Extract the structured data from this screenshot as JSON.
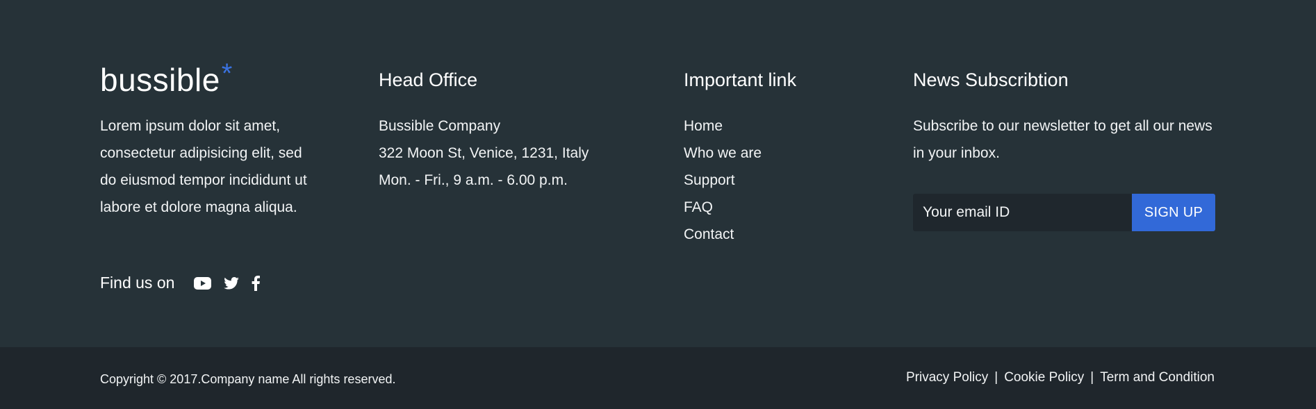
{
  "brand": {
    "logo_light": "buss",
    "logo_bold": "ible",
    "logo_star": "*",
    "accent_color": "#3a72e0",
    "about": "Lorem ipsum dolor sit amet, consectetur adipisicing elit, sed do eiusmod tempor incididunt ut labore et dolore magna aliqua.",
    "find_us_label": "Find us on",
    "social": [
      "youtube-icon",
      "twitter-icon",
      "facebook-icon"
    ]
  },
  "office": {
    "title": "Head Office",
    "lines": [
      "Bussible Company",
      "322 Moon St, Venice, 1231, Italy",
      "Mon. - Fri., 9 a.m. - 6.00 p.m."
    ]
  },
  "links": {
    "title": "Important link",
    "items": [
      "Home",
      "Who we are",
      "Support",
      "FAQ",
      "Contact"
    ]
  },
  "news": {
    "title": "News Subscribtion",
    "text": "Subscribe to our newsletter to get all our news in your inbox.",
    "email_placeholder": "Your email ID",
    "signup_label": "SIGN UP",
    "button_color": "#3269d8"
  },
  "bottom": {
    "copyright": "Copyright © 2017.Company name All rights reserved.",
    "legal": [
      "Privacy Policy",
      "Cookie Policy",
      "Term and Condition"
    ],
    "separator": "|"
  },
  "colors": {
    "background": "#263238",
    "bottom_bar": "#1f262c"
  }
}
